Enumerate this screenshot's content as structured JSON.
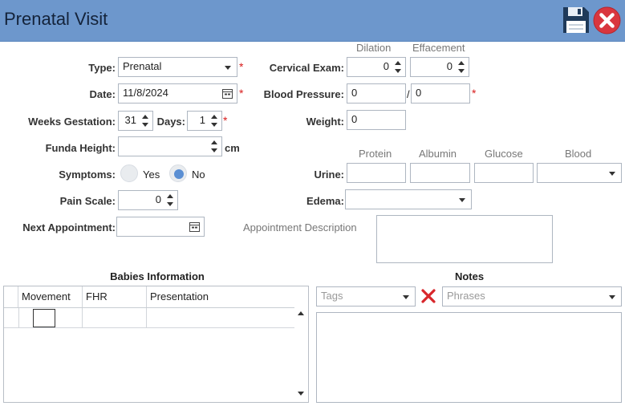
{
  "window": {
    "title": "Prenatal Visit"
  },
  "icons": {
    "save": "floppy-disk-icon",
    "close": "red-close-icon",
    "calendar": "calendar-icon",
    "clear": "red-x-icon"
  },
  "colors": {
    "header": "#6d97cc",
    "required": "#d81b1b",
    "radio_selected": "#5b8fd3",
    "close_button": "#d9363e"
  },
  "form": {
    "type": {
      "label": "Type:",
      "value": "Prenatal",
      "required_mark": "*"
    },
    "date": {
      "label": "Date:",
      "value": "11/8/2024",
      "required_mark": "*"
    },
    "weeks_gestation": {
      "label": "Weeks Gestation:",
      "value": "31"
    },
    "days": {
      "label": "Days:",
      "value": "1",
      "required_mark": "*"
    },
    "funda_height": {
      "label": "Funda Height:",
      "value": "",
      "unit": "cm"
    },
    "symptoms": {
      "label": "Symptoms:",
      "yes_label": "Yes",
      "no_label": "No",
      "selected": "No"
    },
    "pain_scale": {
      "label": "Pain Scale:",
      "value": "0"
    },
    "next_appointment": {
      "label": "Next Appointment:",
      "value": ""
    },
    "cervical_exam": {
      "label": "Cervical Exam:",
      "dilation_label": "Dilation",
      "dilation_value": "0",
      "effacement_label": "Effacement",
      "effacement_value": "0"
    },
    "blood_pressure": {
      "label": "Blood Pressure:",
      "systolic": "0",
      "separator": "/",
      "diastolic": "0",
      "required_mark": "*"
    },
    "weight": {
      "label": "Weight:",
      "value": "0"
    },
    "urine": {
      "label": "Urine:",
      "protein_label": "Protein",
      "albumin_label": "Albumin",
      "glucose_label": "Glucose",
      "blood_label": "Blood",
      "protein": "",
      "albumin": "",
      "glucose": "",
      "blood": ""
    },
    "edema": {
      "label": "Edema:",
      "value": ""
    },
    "appointment_description": {
      "label": "Appointment Description",
      "value": ""
    }
  },
  "babies": {
    "title": "Babies Information",
    "columns": [
      "Movement",
      "FHR",
      "Presentation"
    ]
  },
  "notes": {
    "title": "Notes",
    "tags_placeholder": "Tags",
    "phrases_placeholder": "Phrases",
    "text": ""
  }
}
